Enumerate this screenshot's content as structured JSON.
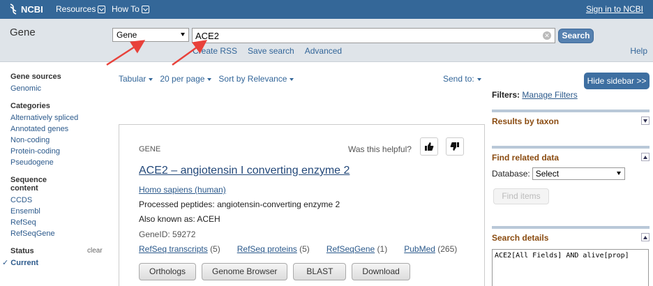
{
  "topbar": {
    "logo": "NCBI",
    "resources": "Resources",
    "howto": "How To",
    "signin": "Sign in to NCBI"
  },
  "search": {
    "db_title": "Gene",
    "db_selected": "Gene",
    "query": "ACE2",
    "button": "Search",
    "links": [
      "Create RSS",
      "Save search",
      "Advanced"
    ],
    "help": "Help"
  },
  "leftnav": {
    "groups": [
      {
        "head": "Gene sources",
        "items": [
          "Genomic"
        ]
      },
      {
        "head": "Categories",
        "items": [
          "Alternatively spliced",
          "Annotated genes",
          "Non-coding",
          "Protein-coding",
          "Pseudogene"
        ]
      },
      {
        "head": "Sequence content",
        "items": [
          "CCDS",
          "Ensembl",
          "RefSeq",
          "RefSeqGene"
        ]
      }
    ],
    "status": {
      "head": "Status",
      "clear": "clear",
      "current": "Current"
    }
  },
  "controls": {
    "format": "Tabular",
    "per_page": "20 per page",
    "sort": "Sort by Relevance",
    "sendto": "Send to:"
  },
  "result": {
    "label": "GENE",
    "helpful": "Was this helpful?",
    "title": "ACE2 – angiotensin I converting enzyme 2",
    "organism": "Homo sapiens (human)",
    "peptides": "Processed peptides: angiotensin-converting enzyme 2",
    "aka": "Also known as: ACEH",
    "geneid": "GeneID: 59272",
    "links": [
      {
        "label": "RefSeq transcripts",
        "count": "(5)"
      },
      {
        "label": "RefSeq proteins",
        "count": "(5)"
      },
      {
        "label": "RefSeqGene",
        "count": "(1)"
      },
      {
        "label": "PubMed",
        "count": "(265)"
      }
    ],
    "buttons": [
      "Orthologs",
      "Genome Browser",
      "BLAST",
      "Download"
    ]
  },
  "sidebar": {
    "hide": "Hide sidebar >>",
    "filters_label": "Filters:",
    "manage_filters": "Manage Filters",
    "taxon_title": "Results by taxon",
    "related_title": "Find related data",
    "database_label": "Database:",
    "database_value": "Select",
    "find_items": "Find items",
    "details_title": "Search details",
    "details_query": "ACE2[All Fields] AND alive[prop]"
  },
  "colors": {
    "topbar": "#346798",
    "link": "#2c5a8c",
    "accent_orange": "#8a4b10",
    "arrow": "#e8413a"
  }
}
